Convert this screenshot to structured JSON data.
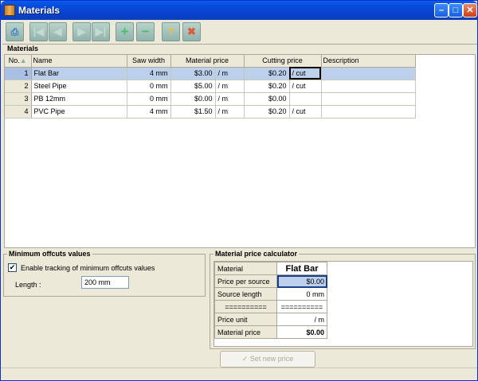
{
  "window": {
    "title": "Materials"
  },
  "toolbar": {
    "buttons": [
      {
        "icon": "print-icon"
      },
      {
        "icon": "first-icon"
      },
      {
        "icon": "prev-icon"
      },
      {
        "icon": "next-icon"
      },
      {
        "icon": "last-icon"
      },
      {
        "icon": "add-icon"
      },
      {
        "icon": "remove-icon"
      },
      {
        "icon": "help-icon"
      },
      {
        "icon": "close-edit-icon"
      }
    ]
  },
  "materials": {
    "section_label": "Materials",
    "columns": [
      "No.",
      "Name",
      "Saw width",
      "Material price",
      "",
      "Cutting price",
      "",
      "Description"
    ],
    "rows": [
      {
        "no": "1",
        "name": "Flat Bar",
        "saw": "4 mm",
        "mprice": "$3.00",
        "munit": "/ m",
        "cprice": "$0.20",
        "cunit": "/ cut",
        "desc": ""
      },
      {
        "no": "2",
        "name": "Steel Pipe",
        "saw": "0 mm",
        "mprice": "$5.00",
        "munit": "/ m",
        "cprice": "$0.20",
        "cunit": "/ cut",
        "desc": ""
      },
      {
        "no": "3",
        "name": "PB 12mm",
        "saw": "0 mm",
        "mprice": "$0.00",
        "munit": "/ m",
        "cprice": "$0.00",
        "cunit": "",
        "desc": ""
      },
      {
        "no": "4",
        "name": "PVC Pipe",
        "saw": "4 mm",
        "mprice": "$1.50",
        "munit": "/ m",
        "cprice": "$0.20",
        "cunit": "/ cut",
        "desc": ""
      }
    ]
  },
  "offcuts": {
    "title": "Minimum offcuts values",
    "enable_label": "Enable tracking of minimum offcuts values",
    "enabled_mark": "✔",
    "length_label": "Length :",
    "length_value": "200 mm"
  },
  "calculator": {
    "title": "Material price calculator",
    "material_label": "Material",
    "material_value": "Flat Bar",
    "rows": [
      {
        "label": "Price per source",
        "value": "$0.00"
      },
      {
        "label": "Source length",
        "value": "0 mm"
      },
      {
        "label": "==========",
        "value": "=========="
      },
      {
        "label": "Price unit",
        "value": "/ m"
      },
      {
        "label": "Material price",
        "value": "$0.00"
      }
    ],
    "set_button": "Set new price"
  }
}
